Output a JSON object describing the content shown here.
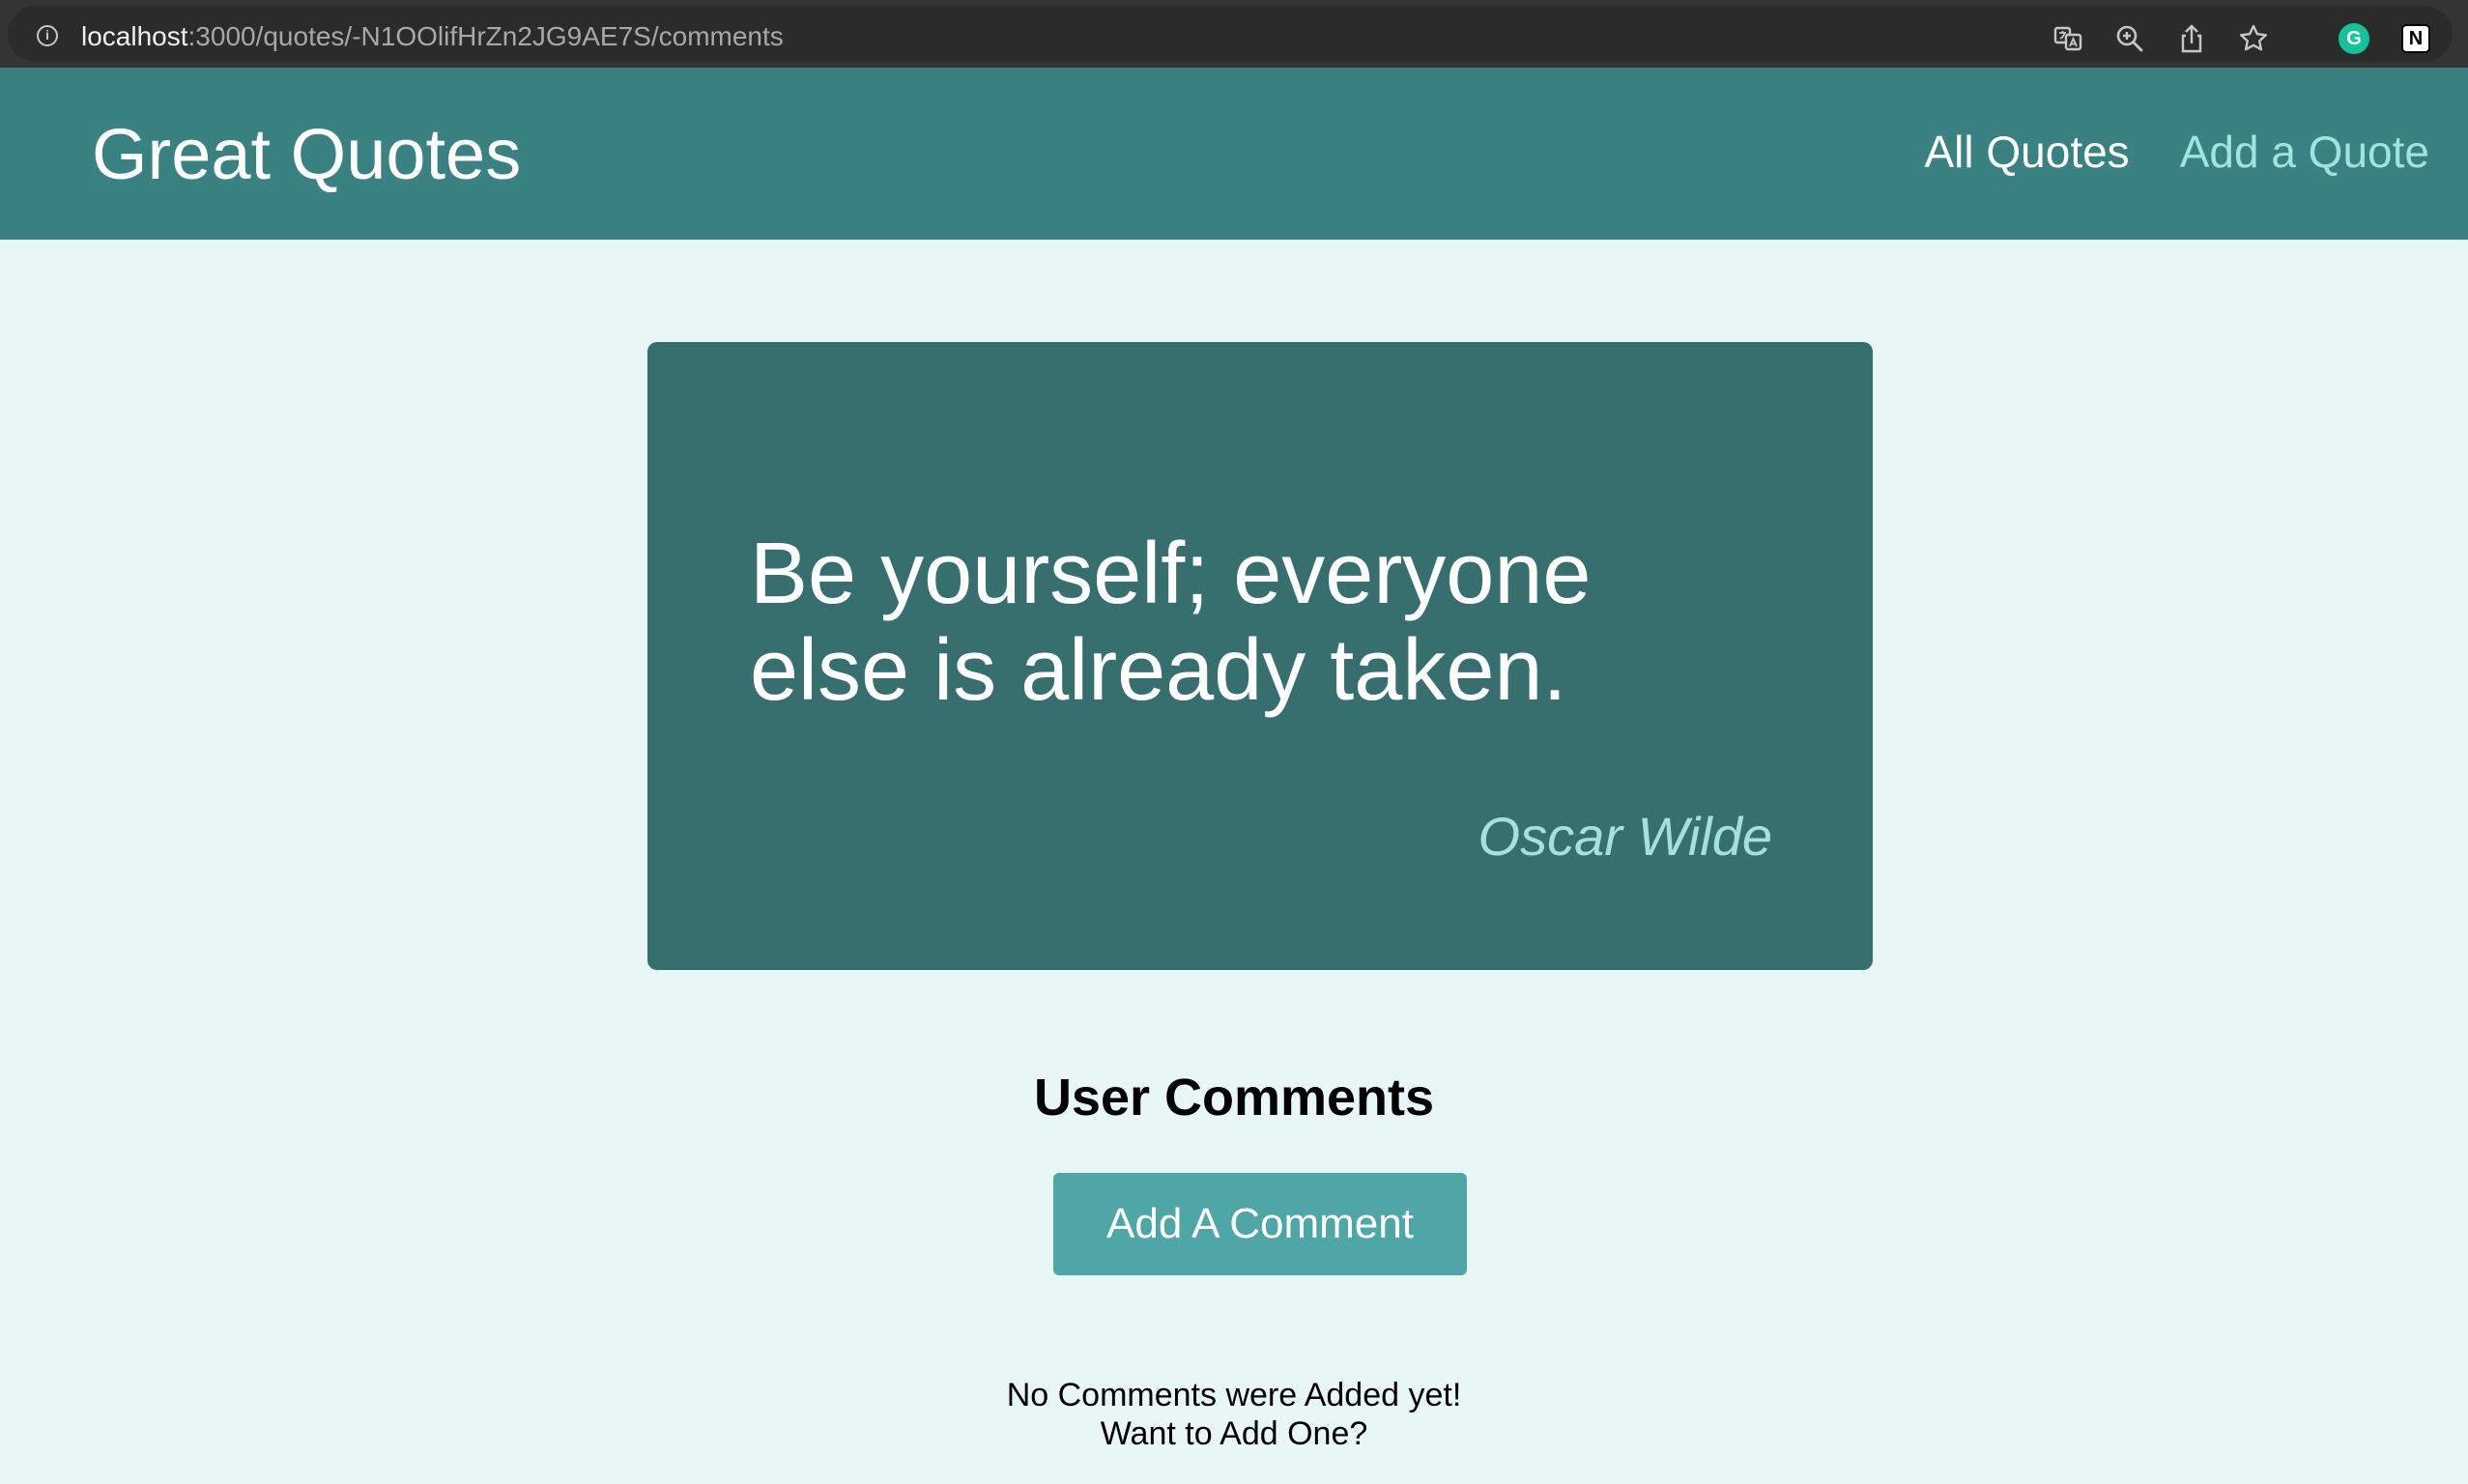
{
  "browser": {
    "url_host": "localhost",
    "url_path": ":3000/quotes/-N1OOlifHrZn2JG9AE7S/comments"
  },
  "header": {
    "logo": "Great Quotes",
    "nav": {
      "all_quotes": "All Quotes",
      "add_quote": "Add a Quote"
    }
  },
  "quote": {
    "text": "Be yourself; everyone else is already taken.",
    "author": "Oscar Wilde"
  },
  "comments": {
    "title": "User Comments",
    "add_button": "Add A Comment",
    "empty_line1": "No Comments were Added yet!",
    "empty_line2": "Want to Add One?"
  },
  "icons": {
    "grammarly_letter": "G",
    "notion_letter": "N"
  },
  "colors": {
    "header_bg": "#3a8281",
    "page_bg": "#e8f6f5",
    "card_bg": "#376f6f",
    "accent": "#9fe4df",
    "button_bg": "#4ea7a6"
  }
}
